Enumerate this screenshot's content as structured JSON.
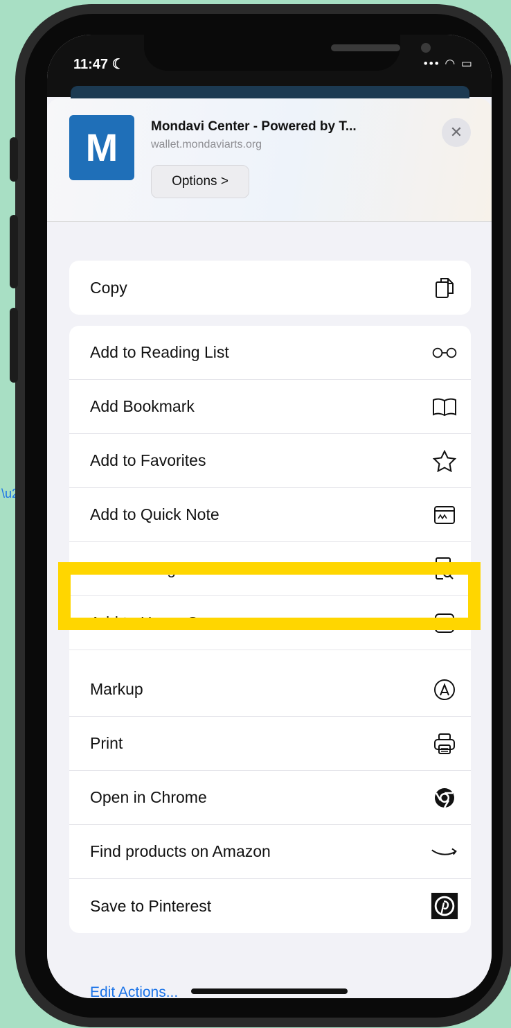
{
  "status": {
    "time": "11:47 ☾",
    "icons": "••• ◠ ▭"
  },
  "header": {
    "app_icon_letter": "M",
    "title": "Mondavi Center - Powered by T...",
    "url": "wallet.mondaviarts.org",
    "options_label": "Options >",
    "close_label": "✕"
  },
  "groups": [
    {
      "items": [
        {
          "label": "Copy",
          "icon": "copy-icon"
        }
      ]
    },
    {
      "items": [
        {
          "label": "Add to Reading List",
          "icon": "glasses-icon"
        },
        {
          "label": "Add Bookmark",
          "icon": "book-icon"
        },
        {
          "label": "Add to Favorites",
          "icon": "star-icon"
        },
        {
          "label": "Add to Quick Note",
          "icon": "quick-note-icon"
        },
        {
          "label": "Find on Page",
          "icon": "find-page-icon"
        },
        {
          "label": "Add to Home Screen",
          "icon": "plus-square-icon"
        },
        {
          "label": "Markup",
          "icon": "markup-icon"
        },
        {
          "label": "Print",
          "icon": "printer-icon"
        },
        {
          "label": "Open in Chrome",
          "icon": "chrome-icon"
        },
        {
          "label": "Find products on Amazon",
          "icon": "amazon-icon"
        },
        {
          "label": "Save to Pinterest",
          "icon": "pinterest-icon"
        }
      ]
    }
  ],
  "edit_actions_label": "Edit Actions...",
  "colors": {
    "highlight": "#ffd600",
    "link": "#1a73e8",
    "app_icon": "#1f6fb8",
    "background": "#a8dfc4"
  }
}
